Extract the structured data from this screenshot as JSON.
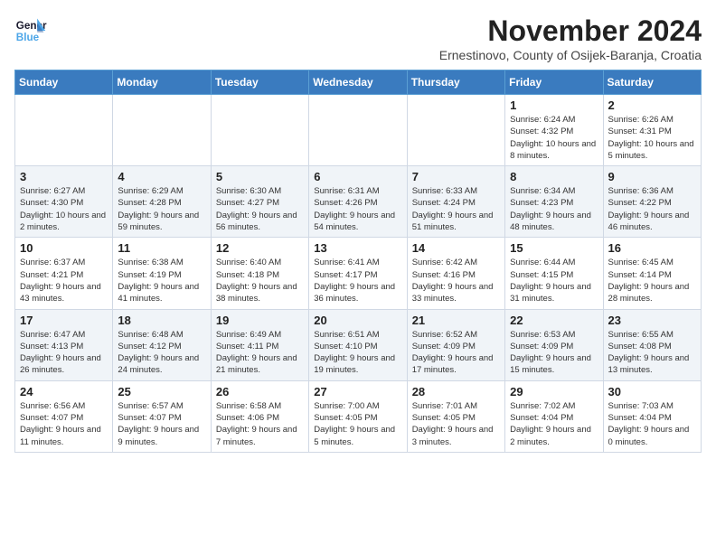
{
  "header": {
    "logo_line1": "General",
    "logo_line2": "Blue",
    "month": "November 2024",
    "location": "Ernestinovo, County of Osijek-Baranja, Croatia"
  },
  "days_of_week": [
    "Sunday",
    "Monday",
    "Tuesday",
    "Wednesday",
    "Thursday",
    "Friday",
    "Saturday"
  ],
  "weeks": [
    [
      {
        "day": "",
        "info": ""
      },
      {
        "day": "",
        "info": ""
      },
      {
        "day": "",
        "info": ""
      },
      {
        "day": "",
        "info": ""
      },
      {
        "day": "",
        "info": ""
      },
      {
        "day": "1",
        "info": "Sunrise: 6:24 AM\nSunset: 4:32 PM\nDaylight: 10 hours and 8 minutes."
      },
      {
        "day": "2",
        "info": "Sunrise: 6:26 AM\nSunset: 4:31 PM\nDaylight: 10 hours and 5 minutes."
      }
    ],
    [
      {
        "day": "3",
        "info": "Sunrise: 6:27 AM\nSunset: 4:30 PM\nDaylight: 10 hours and 2 minutes."
      },
      {
        "day": "4",
        "info": "Sunrise: 6:29 AM\nSunset: 4:28 PM\nDaylight: 9 hours and 59 minutes."
      },
      {
        "day": "5",
        "info": "Sunrise: 6:30 AM\nSunset: 4:27 PM\nDaylight: 9 hours and 56 minutes."
      },
      {
        "day": "6",
        "info": "Sunrise: 6:31 AM\nSunset: 4:26 PM\nDaylight: 9 hours and 54 minutes."
      },
      {
        "day": "7",
        "info": "Sunrise: 6:33 AM\nSunset: 4:24 PM\nDaylight: 9 hours and 51 minutes."
      },
      {
        "day": "8",
        "info": "Sunrise: 6:34 AM\nSunset: 4:23 PM\nDaylight: 9 hours and 48 minutes."
      },
      {
        "day": "9",
        "info": "Sunrise: 6:36 AM\nSunset: 4:22 PM\nDaylight: 9 hours and 46 minutes."
      }
    ],
    [
      {
        "day": "10",
        "info": "Sunrise: 6:37 AM\nSunset: 4:21 PM\nDaylight: 9 hours and 43 minutes."
      },
      {
        "day": "11",
        "info": "Sunrise: 6:38 AM\nSunset: 4:19 PM\nDaylight: 9 hours and 41 minutes."
      },
      {
        "day": "12",
        "info": "Sunrise: 6:40 AM\nSunset: 4:18 PM\nDaylight: 9 hours and 38 minutes."
      },
      {
        "day": "13",
        "info": "Sunrise: 6:41 AM\nSunset: 4:17 PM\nDaylight: 9 hours and 36 minutes."
      },
      {
        "day": "14",
        "info": "Sunrise: 6:42 AM\nSunset: 4:16 PM\nDaylight: 9 hours and 33 minutes."
      },
      {
        "day": "15",
        "info": "Sunrise: 6:44 AM\nSunset: 4:15 PM\nDaylight: 9 hours and 31 minutes."
      },
      {
        "day": "16",
        "info": "Sunrise: 6:45 AM\nSunset: 4:14 PM\nDaylight: 9 hours and 28 minutes."
      }
    ],
    [
      {
        "day": "17",
        "info": "Sunrise: 6:47 AM\nSunset: 4:13 PM\nDaylight: 9 hours and 26 minutes."
      },
      {
        "day": "18",
        "info": "Sunrise: 6:48 AM\nSunset: 4:12 PM\nDaylight: 9 hours and 24 minutes."
      },
      {
        "day": "19",
        "info": "Sunrise: 6:49 AM\nSunset: 4:11 PM\nDaylight: 9 hours and 21 minutes."
      },
      {
        "day": "20",
        "info": "Sunrise: 6:51 AM\nSunset: 4:10 PM\nDaylight: 9 hours and 19 minutes."
      },
      {
        "day": "21",
        "info": "Sunrise: 6:52 AM\nSunset: 4:09 PM\nDaylight: 9 hours and 17 minutes."
      },
      {
        "day": "22",
        "info": "Sunrise: 6:53 AM\nSunset: 4:09 PM\nDaylight: 9 hours and 15 minutes."
      },
      {
        "day": "23",
        "info": "Sunrise: 6:55 AM\nSunset: 4:08 PM\nDaylight: 9 hours and 13 minutes."
      }
    ],
    [
      {
        "day": "24",
        "info": "Sunrise: 6:56 AM\nSunset: 4:07 PM\nDaylight: 9 hours and 11 minutes."
      },
      {
        "day": "25",
        "info": "Sunrise: 6:57 AM\nSunset: 4:07 PM\nDaylight: 9 hours and 9 minutes."
      },
      {
        "day": "26",
        "info": "Sunrise: 6:58 AM\nSunset: 4:06 PM\nDaylight: 9 hours and 7 minutes."
      },
      {
        "day": "27",
        "info": "Sunrise: 7:00 AM\nSunset: 4:05 PM\nDaylight: 9 hours and 5 minutes."
      },
      {
        "day": "28",
        "info": "Sunrise: 7:01 AM\nSunset: 4:05 PM\nDaylight: 9 hours and 3 minutes."
      },
      {
        "day": "29",
        "info": "Sunrise: 7:02 AM\nSunset: 4:04 PM\nDaylight: 9 hours and 2 minutes."
      },
      {
        "day": "30",
        "info": "Sunrise: 7:03 AM\nSunset: 4:04 PM\nDaylight: 9 hours and 0 minutes."
      }
    ]
  ]
}
